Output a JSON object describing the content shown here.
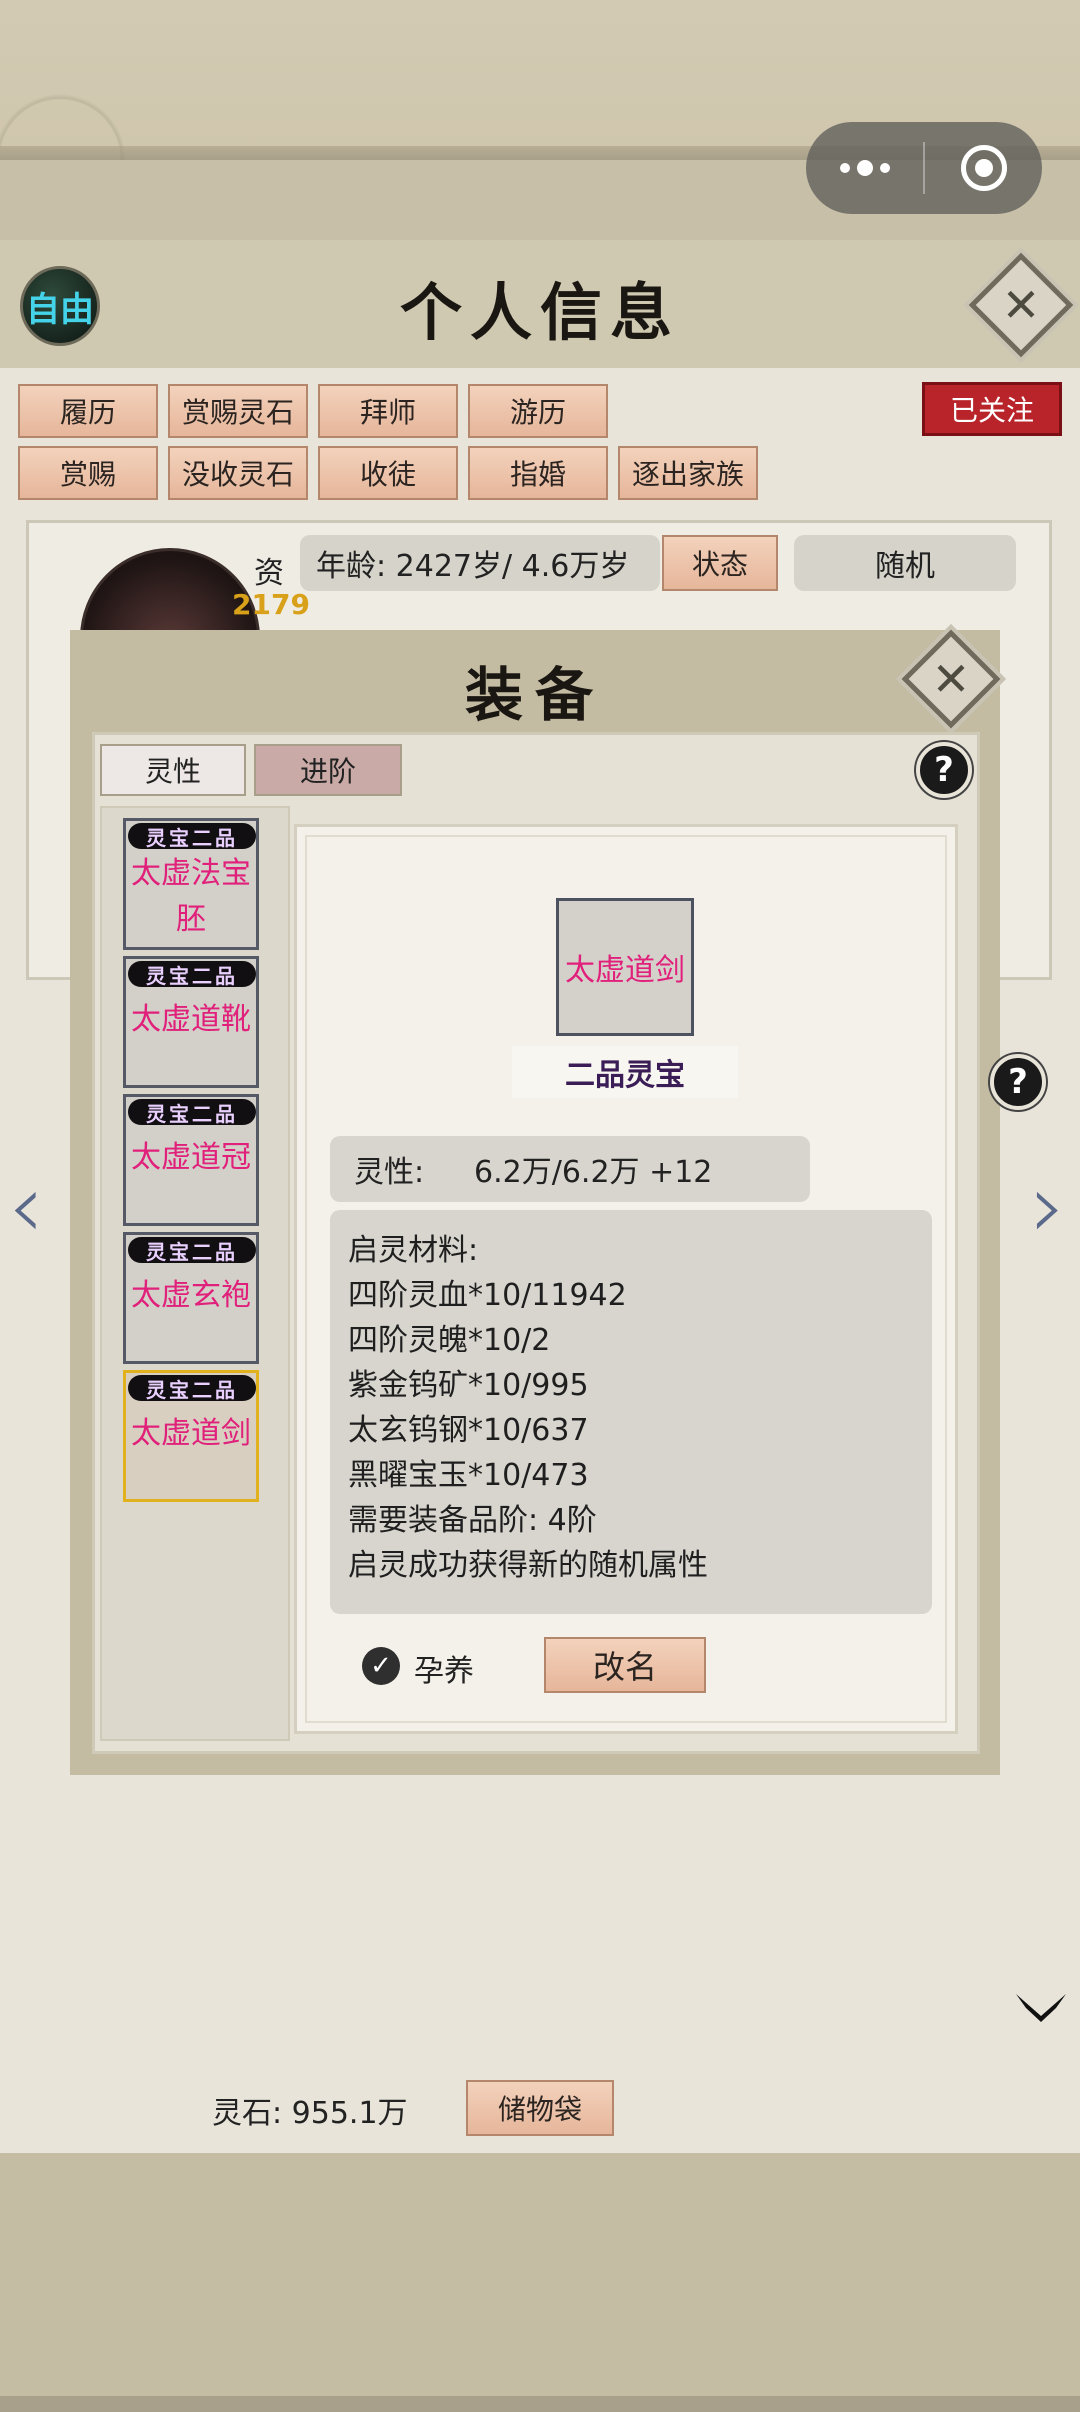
{
  "header": {
    "title": "个人信息",
    "mode_badge": "自由"
  },
  "actions": {
    "row1": [
      "履历",
      "赏赐灵石",
      "拜师",
      "游历"
    ],
    "row2": [
      "赏赐",
      "没收灵石",
      "收徒",
      "指婚",
      "逐出家族"
    ],
    "follow_badge": "已关注"
  },
  "profile": {
    "zi_label": "资",
    "zi_value": "2179",
    "age": "年龄: 2427岁/ 4.6万岁",
    "status_button": "状态",
    "random_label": "随机"
  },
  "equip": {
    "title": "装备",
    "tabs": [
      "灵性",
      "进阶"
    ],
    "items": [
      {
        "tag": "灵宝二品",
        "name": "太虚法宝胚"
      },
      {
        "tag": "灵宝二品",
        "name": "太虚道靴"
      },
      {
        "tag": "灵宝二品",
        "name": "太虚道冠"
      },
      {
        "tag": "灵宝二品",
        "name": "太虚玄袍"
      },
      {
        "tag": "灵宝二品",
        "name": "太虚道剑"
      }
    ],
    "selected": {
      "name": "太虚道剑",
      "grade": "二品灵宝",
      "stat_label": "灵性:",
      "stat_value": "6.2万/6.2万 +12",
      "materials": [
        "启灵材料:",
        "四阶灵血*10/11942",
        "四阶灵魄*10/2",
        "紫金钨矿*10/995",
        "太玄钨钢*10/637",
        "黑曜宝玉*10/473",
        "需要装备品阶: 4阶",
        "启灵成功获得新的随机属性"
      ],
      "nurture_label": "孕养",
      "rename_button": "改名"
    }
  },
  "footer": {
    "spirit_stone": "灵石: 955.1万",
    "bag_button": "储物袋"
  }
}
